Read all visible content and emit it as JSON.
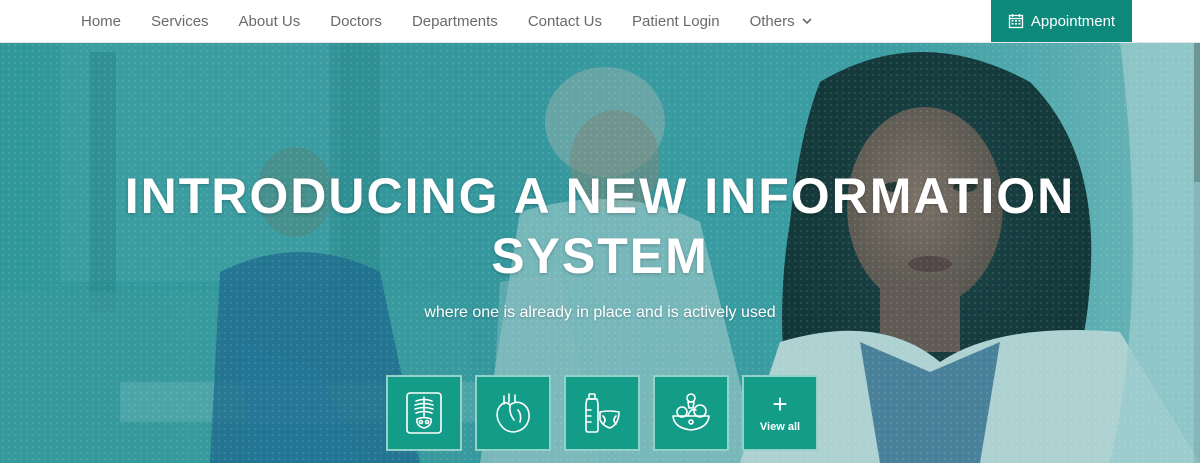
{
  "nav": {
    "items": [
      {
        "label": "Home"
      },
      {
        "label": "Services"
      },
      {
        "label": "About Us"
      },
      {
        "label": "Doctors"
      },
      {
        "label": "Departments"
      },
      {
        "label": "Contact Us"
      },
      {
        "label": "Patient Login"
      },
      {
        "label": "Others",
        "has_dropdown": true
      }
    ],
    "appointment_label": "Appointment",
    "appointment_icon": "calendar-icon"
  },
  "hero": {
    "title": "INTRODUCING A NEW INFORMATION SYSTEM",
    "subtitle": "where one is already in place and is actively used",
    "tiles": [
      {
        "icon": "xray-icon"
      },
      {
        "icon": "heart-icon"
      },
      {
        "icon": "baby-care-icon"
      },
      {
        "icon": "nutrition-icon"
      },
      {
        "icon": "plus-icon",
        "label": "View all"
      }
    ]
  },
  "colors": {
    "accent": "#0e8a7d",
    "tile": "#139c87",
    "nav_text": "#6a6a6a",
    "hero_tint": "#2a8b8f"
  }
}
